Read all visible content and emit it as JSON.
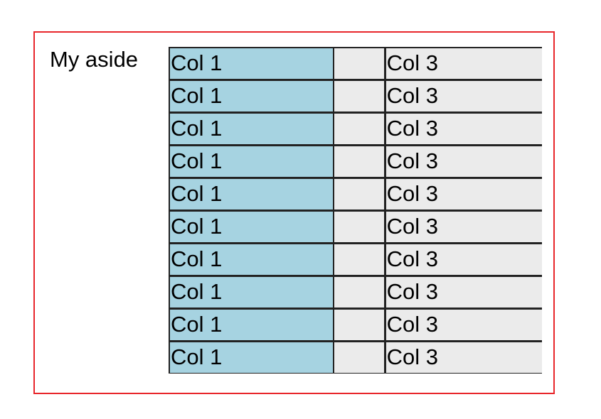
{
  "aside": {
    "text": "My aside"
  },
  "table": {
    "rows": [
      {
        "col1": "Col 1",
        "col2": "",
        "col3": "Col 3"
      },
      {
        "col1": "Col 1",
        "col2": "",
        "col3": "Col 3"
      },
      {
        "col1": "Col 1",
        "col2": "",
        "col3": "Col 3"
      },
      {
        "col1": "Col 1",
        "col2": "",
        "col3": "Col 3"
      },
      {
        "col1": "Col 1",
        "col2": "",
        "col3": "Col 3"
      },
      {
        "col1": "Col 1",
        "col2": "",
        "col3": "Col 3"
      },
      {
        "col1": "Col 1",
        "col2": "",
        "col3": "Col 3"
      },
      {
        "col1": "Col 1",
        "col2": "",
        "col3": "Col 3"
      },
      {
        "col1": "Col 1",
        "col2": "",
        "col3": "Col 3"
      },
      {
        "col1": "Col 1",
        "col2": "",
        "col3": "Col 3"
      }
    ]
  },
  "colors": {
    "frame_border": "#e8262b",
    "col1_bg": "#a6d3e1",
    "cell_bg": "#ebebeb"
  }
}
